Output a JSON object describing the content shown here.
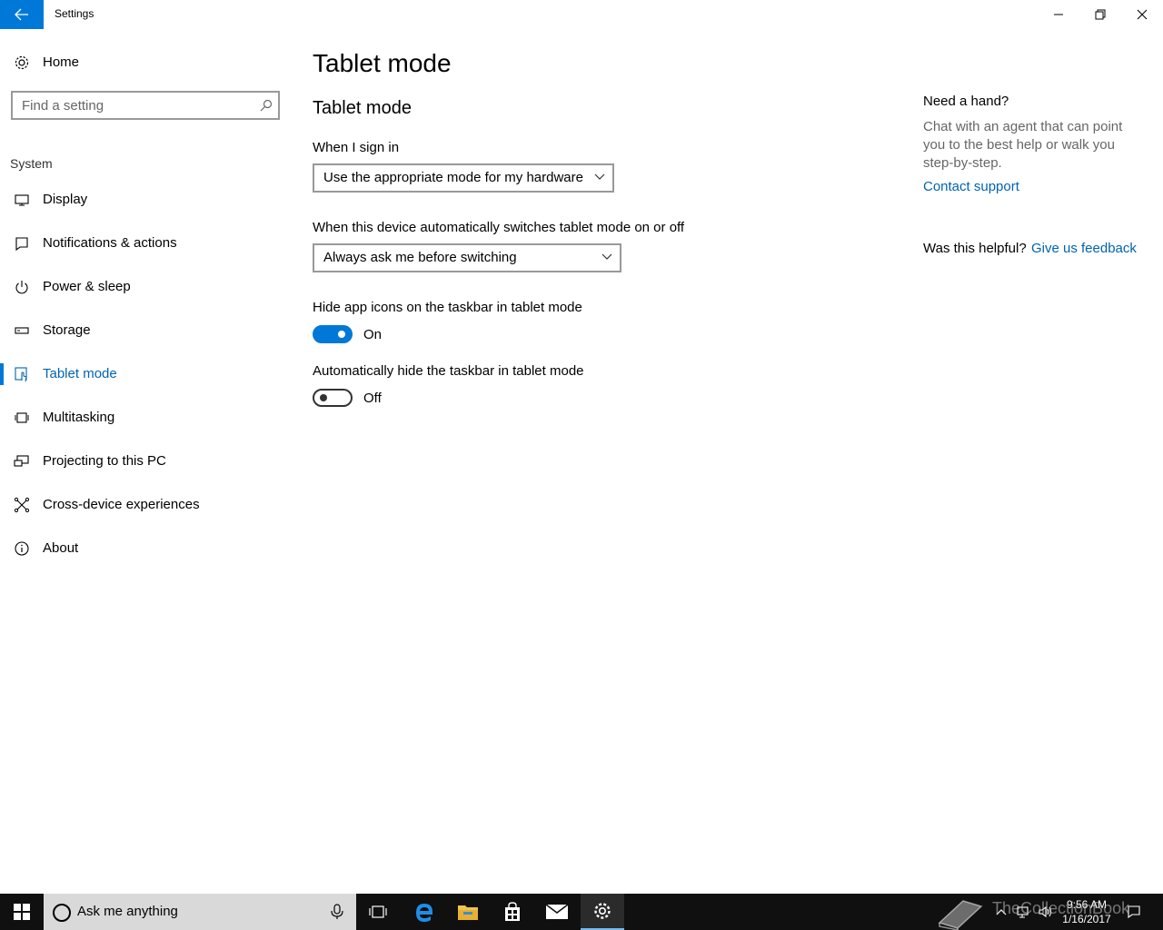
{
  "window": {
    "title": "Settings"
  },
  "sidebar": {
    "home_label": "Home",
    "search_placeholder": "Find a setting",
    "section_label": "System",
    "items": [
      {
        "label": "Display",
        "icon": "display-icon"
      },
      {
        "label": "Notifications & actions",
        "icon": "notifications-icon"
      },
      {
        "label": "Power & sleep",
        "icon": "power-icon"
      },
      {
        "label": "Storage",
        "icon": "storage-icon"
      },
      {
        "label": "Tablet mode",
        "icon": "tablet-mode-icon",
        "active": true
      },
      {
        "label": "Multitasking",
        "icon": "multitasking-icon"
      },
      {
        "label": "Projecting to this PC",
        "icon": "projecting-icon"
      },
      {
        "label": "Cross-device experiences",
        "icon": "cross-device-icon"
      },
      {
        "label": "About",
        "icon": "info-icon"
      }
    ]
  },
  "main": {
    "page_title": "Tablet mode",
    "section_title": "Tablet mode",
    "sign_in": {
      "label": "When I sign in",
      "value": "Use the appropriate mode for my hardware"
    },
    "auto_switch": {
      "label": "When this device automatically switches tablet mode on or off",
      "value": "Always ask me before switching"
    },
    "hide_icons": {
      "label": "Hide app icons on the taskbar in tablet mode",
      "state": "On",
      "on": true
    },
    "hide_taskbar": {
      "label": "Automatically hide the taskbar in tablet mode",
      "state": "Off",
      "on": false
    }
  },
  "help": {
    "title": "Need a hand?",
    "text": "Chat with an agent that can point you to the best help or walk you step-by-step.",
    "link": "Contact support",
    "helpful_question": "Was this helpful?",
    "feedback_link": "Give us feedback"
  },
  "taskbar": {
    "search_text": "Ask me anything",
    "time": "9:56 AM",
    "date": "1/16/2017",
    "watermark": "TheCollectionBook"
  },
  "colors": {
    "accent": "#0078d7",
    "link": "#0063b1",
    "taskbar": "#101010"
  }
}
